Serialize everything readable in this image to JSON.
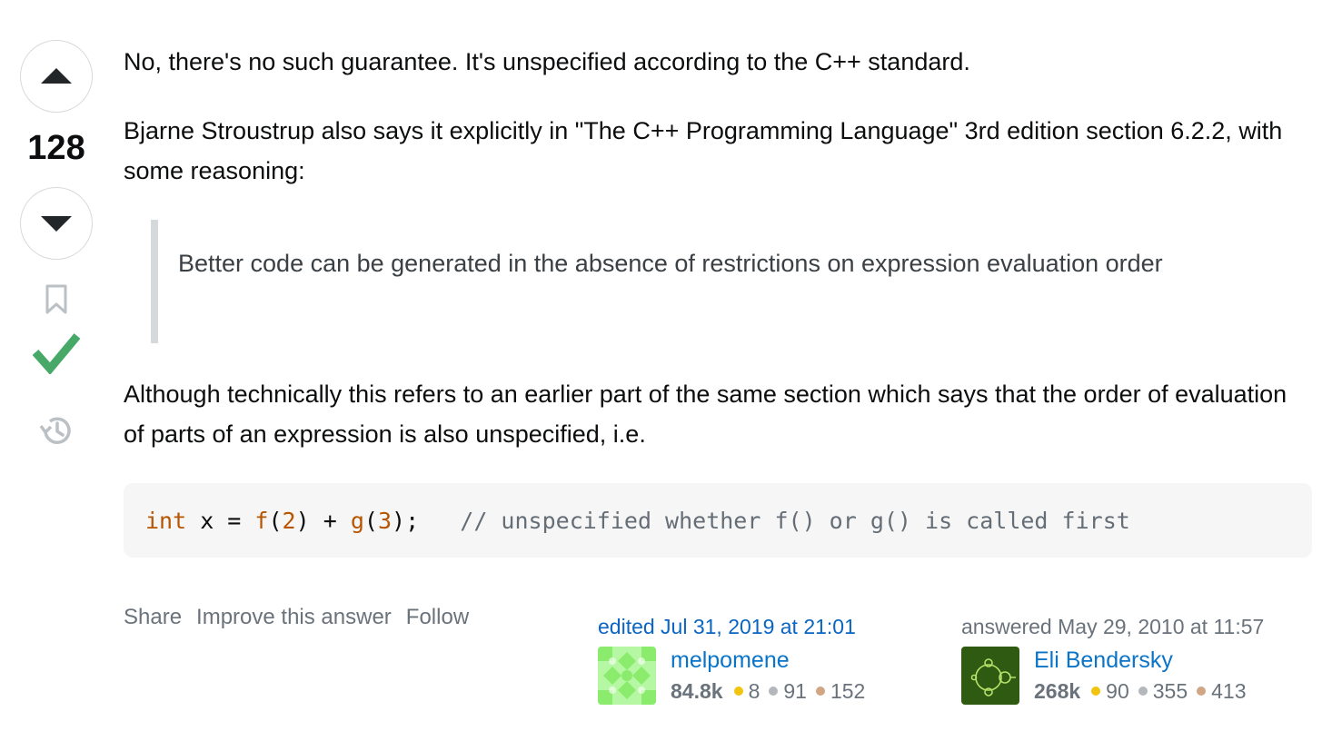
{
  "vote": {
    "count": "128"
  },
  "answer": {
    "paragraph1": "No, there's no such guarantee. It's unspecified according to the C++ standard.",
    "paragraph2": "Bjarne Stroustrup also says it explicitly in \"The C++ Programming Language\" 3rd edition section 6.2.2, with some reasoning:",
    "blockquote": "Better code can be generated in the absence of restrictions on expression evaluation order",
    "paragraph3": "Although technically this refers to an earlier part of the same section which says that the order of evaluation of parts of an expression is also unspecified, i.e.",
    "code": {
      "kw_int": "int",
      "t1": " x = ",
      "f_name": "f",
      "t2": "(",
      "n1": "2",
      "t3": ") + ",
      "g_name": "g",
      "t4": "(",
      "n2": "3",
      "t5": ");   ",
      "comment": "// unspecified whether f() or g() is called first"
    }
  },
  "menu": {
    "share": "Share",
    "improve": "Improve this answer",
    "follow": "Follow"
  },
  "editor": {
    "action": "edited Jul 31, 2019 at 21:01",
    "name": "melpomene",
    "reputation": "84.8k",
    "gold": "8",
    "silver": "91",
    "bronze": "152"
  },
  "owner": {
    "action": "answered May 29, 2010 at 11:57",
    "name": "Eli Bendersky",
    "reputation": "268k",
    "gold": "90",
    "silver": "355",
    "bronze": "413"
  },
  "colors": {
    "accepted": "#48a868",
    "link": "#0a74c8",
    "code_keyword": "#b75501",
    "code_comment": "#656e77"
  },
  "icons": [
    "upvote-arrow-icon",
    "downvote-arrow-icon",
    "bookmark-icon",
    "accepted-checkmark-icon",
    "history-icon"
  ]
}
